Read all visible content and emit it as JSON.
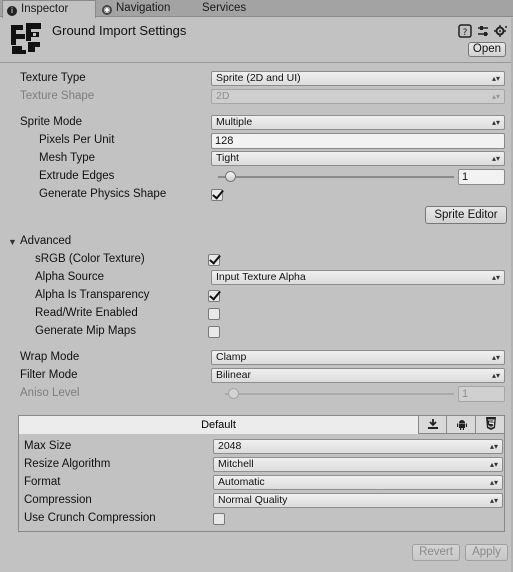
{
  "tabs": [
    {
      "label": "Inspector",
      "icon": "info-icon",
      "active": true
    },
    {
      "label": "Navigation",
      "icon": "navigation-icon",
      "active": false
    },
    {
      "label": "Services",
      "icon": "",
      "active": false
    }
  ],
  "header": {
    "title": "Ground Import Settings",
    "open_label": "Open",
    "icons": [
      "help-icon",
      "preset-icon",
      "settings-gear-icon"
    ]
  },
  "texture": {
    "type_label": "Texture Type",
    "type_value": "Sprite (2D and UI)",
    "shape_label": "Texture Shape",
    "shape_value": "2D"
  },
  "sprite": {
    "mode_label": "Sprite Mode",
    "mode_value": "Multiple",
    "ppu_label": "Pixels Per Unit",
    "ppu_value": "128",
    "mesh_label": "Mesh Type",
    "mesh_value": "Tight",
    "extrude_label": "Extrude Edges",
    "extrude_value": "1",
    "extrude_fraction": 0.03,
    "physics_label": "Generate Physics Shape",
    "physics_checked": true,
    "editor_button": "Sprite Editor"
  },
  "advanced": {
    "label": "Advanced",
    "srgb_label": "sRGB (Color Texture)",
    "srgb_checked": true,
    "alpha_source_label": "Alpha Source",
    "alpha_source_value": "Input Texture Alpha",
    "alpha_transparency_label": "Alpha Is Transparency",
    "alpha_transparency_checked": true,
    "readwrite_label": "Read/Write Enabled",
    "readwrite_checked": false,
    "mipmaps_label": "Generate Mip Maps",
    "mipmaps_checked": false
  },
  "wrap": {
    "label": "Wrap Mode",
    "value": "Clamp"
  },
  "filter": {
    "label": "Filter Mode",
    "value": "Bilinear"
  },
  "aniso": {
    "label": "Aniso Level",
    "value": "1",
    "fraction": 0.0
  },
  "platform": {
    "default_tab": "Default",
    "platform_icons": [
      "standalone-download-icon",
      "android-icon",
      "html5-icon"
    ],
    "maxsize_label": "Max Size",
    "maxsize_value": "2048",
    "resize_label": "Resize Algorithm",
    "resize_value": "Mitchell",
    "format_label": "Format",
    "format_value": "Automatic",
    "compression_label": "Compression",
    "compression_value": "Normal Quality",
    "crunch_label": "Use Crunch Compression",
    "crunch_checked": false
  },
  "footer": {
    "revert_label": "Revert",
    "apply_label": "Apply"
  },
  "colors": {
    "background": "#c2c2c2",
    "tab_bar": "#a3a3a3"
  }
}
